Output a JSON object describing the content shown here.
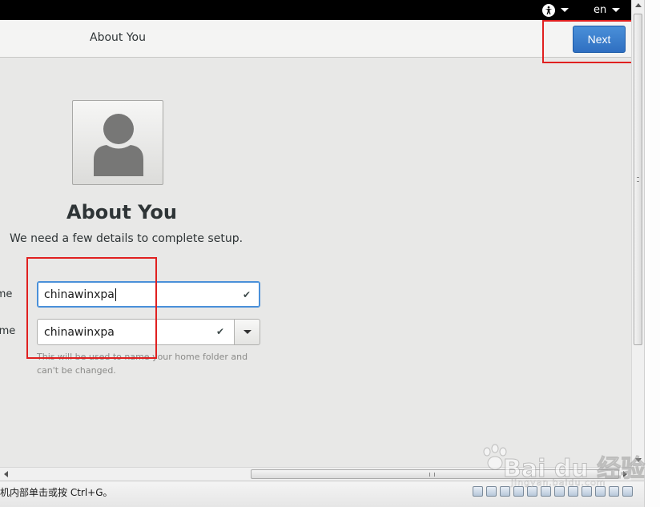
{
  "topbar": {
    "accessibility_icon": "accessibility-icon",
    "language": "en"
  },
  "header": {
    "title": "About You",
    "next_label": "Next"
  },
  "main": {
    "avatar_icon": "user-avatar-icon",
    "title": "About You",
    "subtitle": "We need a few details to complete setup.",
    "full_name": {
      "label": "Name",
      "value": "chinawinxpa"
    },
    "username": {
      "label": "Username",
      "value": "chinawinxpa"
    },
    "hint": "This will be used to name your home folder and can't be changed.",
    "check_glyph": "✔"
  },
  "statusbar": {
    "text": "机内部单击或按 Ctrl+G。"
  },
  "watermark": {
    "brand": "Bai du 经验",
    "url": "jingyan.baidu.com"
  },
  "colors": {
    "accent": "#2f6fc1",
    "highlight_box": "#e02020",
    "background": "#e8e8e7"
  }
}
